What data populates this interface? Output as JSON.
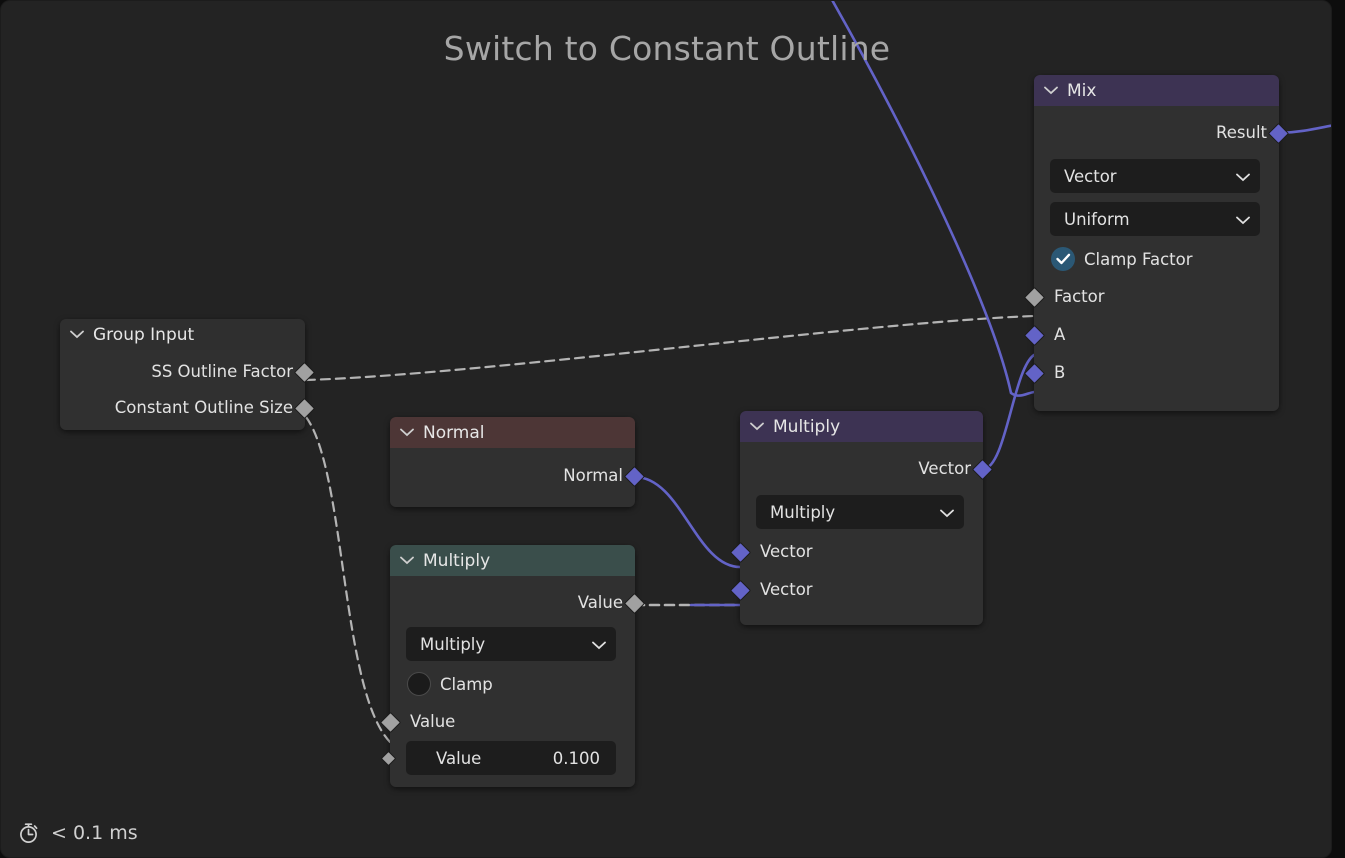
{
  "editor": {
    "title": "Switch to Constant Outline",
    "status_text": "< 0.1 ms",
    "status_icon": "stopwatch-icon",
    "background_color": "#232323",
    "noodle_color_vector": "#6363c7",
    "noodle_color_value": "#a8a8a8"
  },
  "nodes": {
    "group_input": {
      "title": "Group Input",
      "header_color": "#2f2f2f",
      "outputs": [
        {
          "label": "SS Outline Factor",
          "socket_type": "value"
        },
        {
          "label": "Constant Outline Size",
          "socket_type": "value"
        }
      ]
    },
    "normal": {
      "title": "Normal",
      "header_color": "#4d3636",
      "outputs": [
        {
          "label": "Normal",
          "socket_type": "vector"
        }
      ]
    },
    "math_multiply": {
      "title": "Multiply",
      "header_color": "#3a4e4b",
      "outputs": [
        {
          "label": "Value",
          "socket_type": "value"
        }
      ],
      "operation": "Multiply",
      "clamp_label": "Clamp",
      "clamp_checked": false,
      "inputs": [
        {
          "label": "Value",
          "socket_type": "value"
        }
      ],
      "value_field": {
        "label": "Value",
        "value": "0.100"
      }
    },
    "vector_multiply": {
      "title": "Multiply",
      "header_color": "#3d3353",
      "outputs": [
        {
          "label": "Vector",
          "socket_type": "vector"
        }
      ],
      "operation": "Multiply",
      "inputs": [
        {
          "label": "Vector",
          "socket_type": "vector"
        },
        {
          "label": "Vector",
          "socket_type": "vector"
        }
      ]
    },
    "mix": {
      "title": "Mix",
      "header_color": "#3d3353",
      "outputs": [
        {
          "label": "Result",
          "socket_type": "vector"
        }
      ],
      "data_type": "Vector",
      "blend_mode": "Uniform",
      "clamp_label": "Clamp Factor",
      "clamp_checked": true,
      "inputs": [
        {
          "label": "Factor",
          "socket_type": "value"
        },
        {
          "label": "A",
          "socket_type": "vector"
        },
        {
          "label": "B",
          "socket_type": "vector"
        }
      ]
    }
  }
}
